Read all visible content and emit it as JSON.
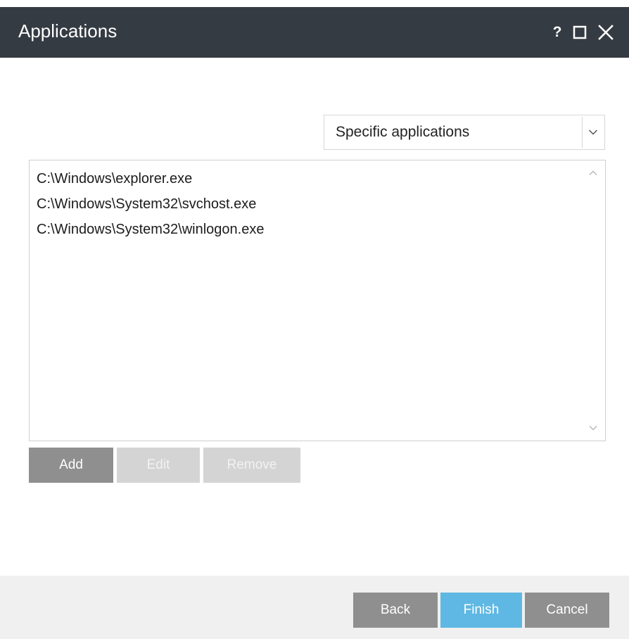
{
  "window": {
    "title": "Applications",
    "help_glyph": "?",
    "icons": [
      "help-icon",
      "maximize-icon",
      "close-icon"
    ]
  },
  "scope_dropdown": {
    "selected": "Specific applications",
    "icon": "chevron-down-icon"
  },
  "applications": {
    "items": [
      "C:\\Windows\\explorer.exe",
      "C:\\Windows\\System32\\svchost.exe",
      "C:\\Windows\\System32\\winlogon.exe"
    ],
    "scroll_icons": [
      "chevron-up-icon",
      "chevron-down-icon"
    ]
  },
  "list_actions": {
    "add": "Add",
    "edit": "Edit",
    "remove": "Remove"
  },
  "footer": {
    "back": "Back",
    "finish": "Finish",
    "cancel": "Cancel"
  },
  "colors": {
    "titlebar": "#353b42",
    "primary_button": "#5fb8e3",
    "secondary_button": "#8f8f8f",
    "disabled_button": "#d4d4d4",
    "footer_bg": "#f0f0f0"
  }
}
